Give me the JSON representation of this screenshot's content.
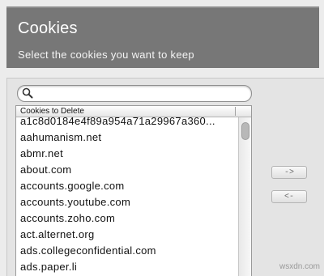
{
  "header": {
    "title": "Cookies",
    "subtitle": "Select the cookies you want to keep"
  },
  "search": {
    "value": "",
    "placeholder": ""
  },
  "cookie_list": {
    "column_header": "Cookies to Delete",
    "items": [
      "a1c8d0184e4f89a954a71a29967a360...",
      "aahumanism.net",
      "abmr.net",
      "about.com",
      "accounts.google.com",
      "accounts.youtube.com",
      "accounts.zoho.com",
      "act.alternet.org",
      "ads.collegeconfidential.com",
      "ads.paper.li"
    ]
  },
  "buttons": {
    "add_label": "->",
    "remove_label": "<-"
  },
  "watermark": "wsxdn.com",
  "icons": {
    "search": "search-icon"
  },
  "colors": {
    "header_bg": "#777777",
    "panel_bg": "#e4e4e4"
  }
}
